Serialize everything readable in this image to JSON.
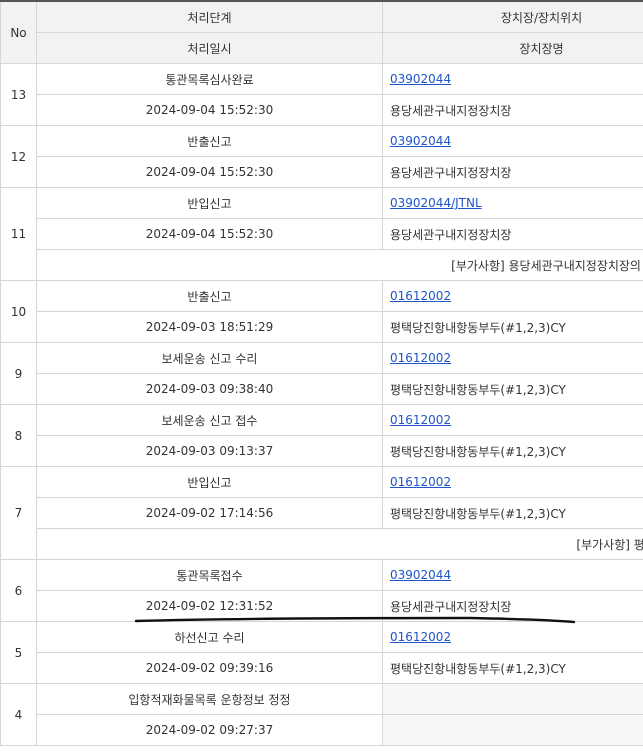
{
  "header": {
    "no": "No",
    "stage": "처리단계",
    "datetime": "처리일시",
    "location": "장치장/장치위치",
    "location_name": "장치장명"
  },
  "records": [
    {
      "no": "13",
      "stage": "통관목록심사완료",
      "datetime": "2024-09-04 15:52:30",
      "code": "03902044",
      "name": "용당세관구내지정장치장"
    },
    {
      "no": "12",
      "stage": "반출신고",
      "datetime": "2024-09-04 15:52:30",
      "code": "03902044",
      "name": "용당세관구내지정장치장"
    },
    {
      "no": "11",
      "stage": "반입신고",
      "datetime": "2024-09-04 15:52:30",
      "code": "03902044/JTNL",
      "name": "용당세관구내지정장치장",
      "note": "[부가사항] 용당세관구내지정장치장의 장치기간은"
    },
    {
      "no": "10",
      "stage": "반출신고",
      "datetime": "2024-09-03 18:51:29",
      "code": "01612002",
      "name": "평택당진항내항동부두(#1,2,3)CY"
    },
    {
      "no": "9",
      "stage": "보세운송 신고 수리",
      "datetime": "2024-09-03 09:38:40",
      "code": "01612002",
      "name": "평택당진항내항동부두(#1,2,3)CY"
    },
    {
      "no": "8",
      "stage": "보세운송 신고 접수",
      "datetime": "2024-09-03 09:13:37",
      "code": "01612002",
      "name": "평택당진항내항동부두(#1,2,3)CY"
    },
    {
      "no": "7",
      "stage": "반입신고",
      "datetime": "2024-09-02 17:14:56",
      "code": "01612002",
      "name": "평택당진항내항동부두(#1,2,3)CY",
      "note": "[부가사항] 평택당진항내"
    },
    {
      "no": "6",
      "stage": "통관목록접수",
      "datetime": "2024-09-02 12:31:52",
      "code": "03902044",
      "name": "용당세관구내지정장치장"
    },
    {
      "no": "5",
      "stage": "하선신고 수리",
      "datetime": "2024-09-02 09:39:16",
      "code": "01612002",
      "name": "평택당진항내항동부두(#1,2,3)CY"
    },
    {
      "no": "4",
      "stage": "입항적재화물목록 운항정보 정정",
      "datetime": "2024-09-02 09:27:37",
      "code": "",
      "name": ""
    }
  ]
}
